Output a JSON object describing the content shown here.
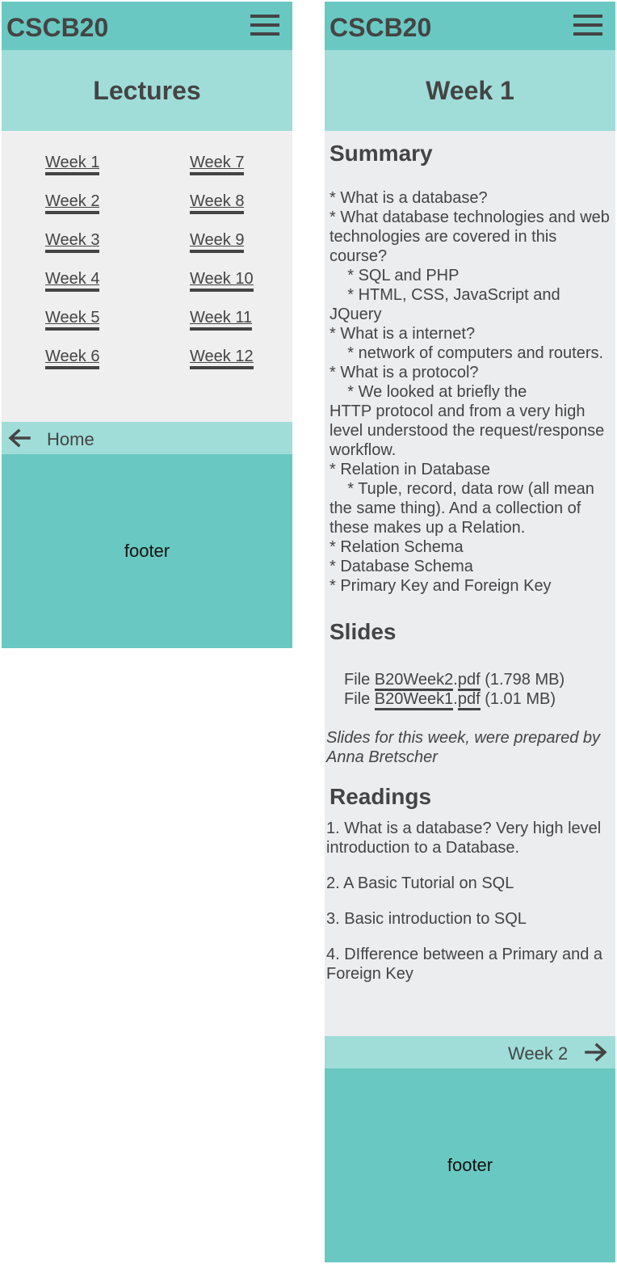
{
  "brand": "CSCB20",
  "left": {
    "title": "Lectures",
    "weeks_col1": [
      "Week 1",
      "Week 2",
      "Week 3",
      "Week 4",
      "Week 5",
      "Week 6"
    ],
    "weeks_col2": [
      "Week 7",
      "Week 8",
      "Week 9",
      "Week 10",
      "Week 11",
      "Week 12"
    ],
    "nav_label": "Home",
    "footer": "footer"
  },
  "right": {
    "title": "Week 1",
    "summary_heading": "Summary",
    "summary_lines": [
      "* What is a database?",
      "* What database technologies and web",
      "technologies are covered in this",
      "course?",
      "    * SQL and PHP",
      "    * HTML, CSS, JavaScript and",
      "JQuery",
      "* What is a internet?",
      "    * network of computers and routers.",
      "* What is a protocol?",
      "    * We looked at briefly the",
      "HTTP protocol and from a very high",
      "level understood the request/response",
      "workflow.",
      "* Relation in Database",
      "    * Tuple, record, data row (all mean",
      "the same thing). And a collection of",
      "these makes up a Relation.",
      "* Relation Schema",
      "* Database Schema",
      "* Primary Key and Foreign Key"
    ],
    "slides_heading": "Slides",
    "slides": [
      {
        "prefix": "File ",
        "name": "B20Week2",
        "ext": "pdf",
        "size": " (1.798 MB)"
      },
      {
        "prefix": "File ",
        "name": "B20Week1",
        "ext": "pdf",
        "size": " (1.01 MB)"
      }
    ],
    "slides_credit": "Slides for this week, were prepared by Anna Bretscher",
    "readings_heading": "Readings",
    "readings": [
      "1. What is a database? Very high level introduction to a Database.",
      "2. A Basic Tutorial on SQL",
      "3. Basic introduction to SQL",
      "4. DIfference between a Primary and a Foreign Key"
    ],
    "nav_label": "Week 2",
    "footer": "footer"
  },
  "icons": {
    "menu": "hamburger-menu-icon",
    "back": "arrow-left-icon",
    "next": "arrow-right-icon"
  },
  "colors": {
    "header": "#69c8c2",
    "title_band": "#a0ddd9",
    "page_bg": "#efefef",
    "text": "#444444"
  }
}
